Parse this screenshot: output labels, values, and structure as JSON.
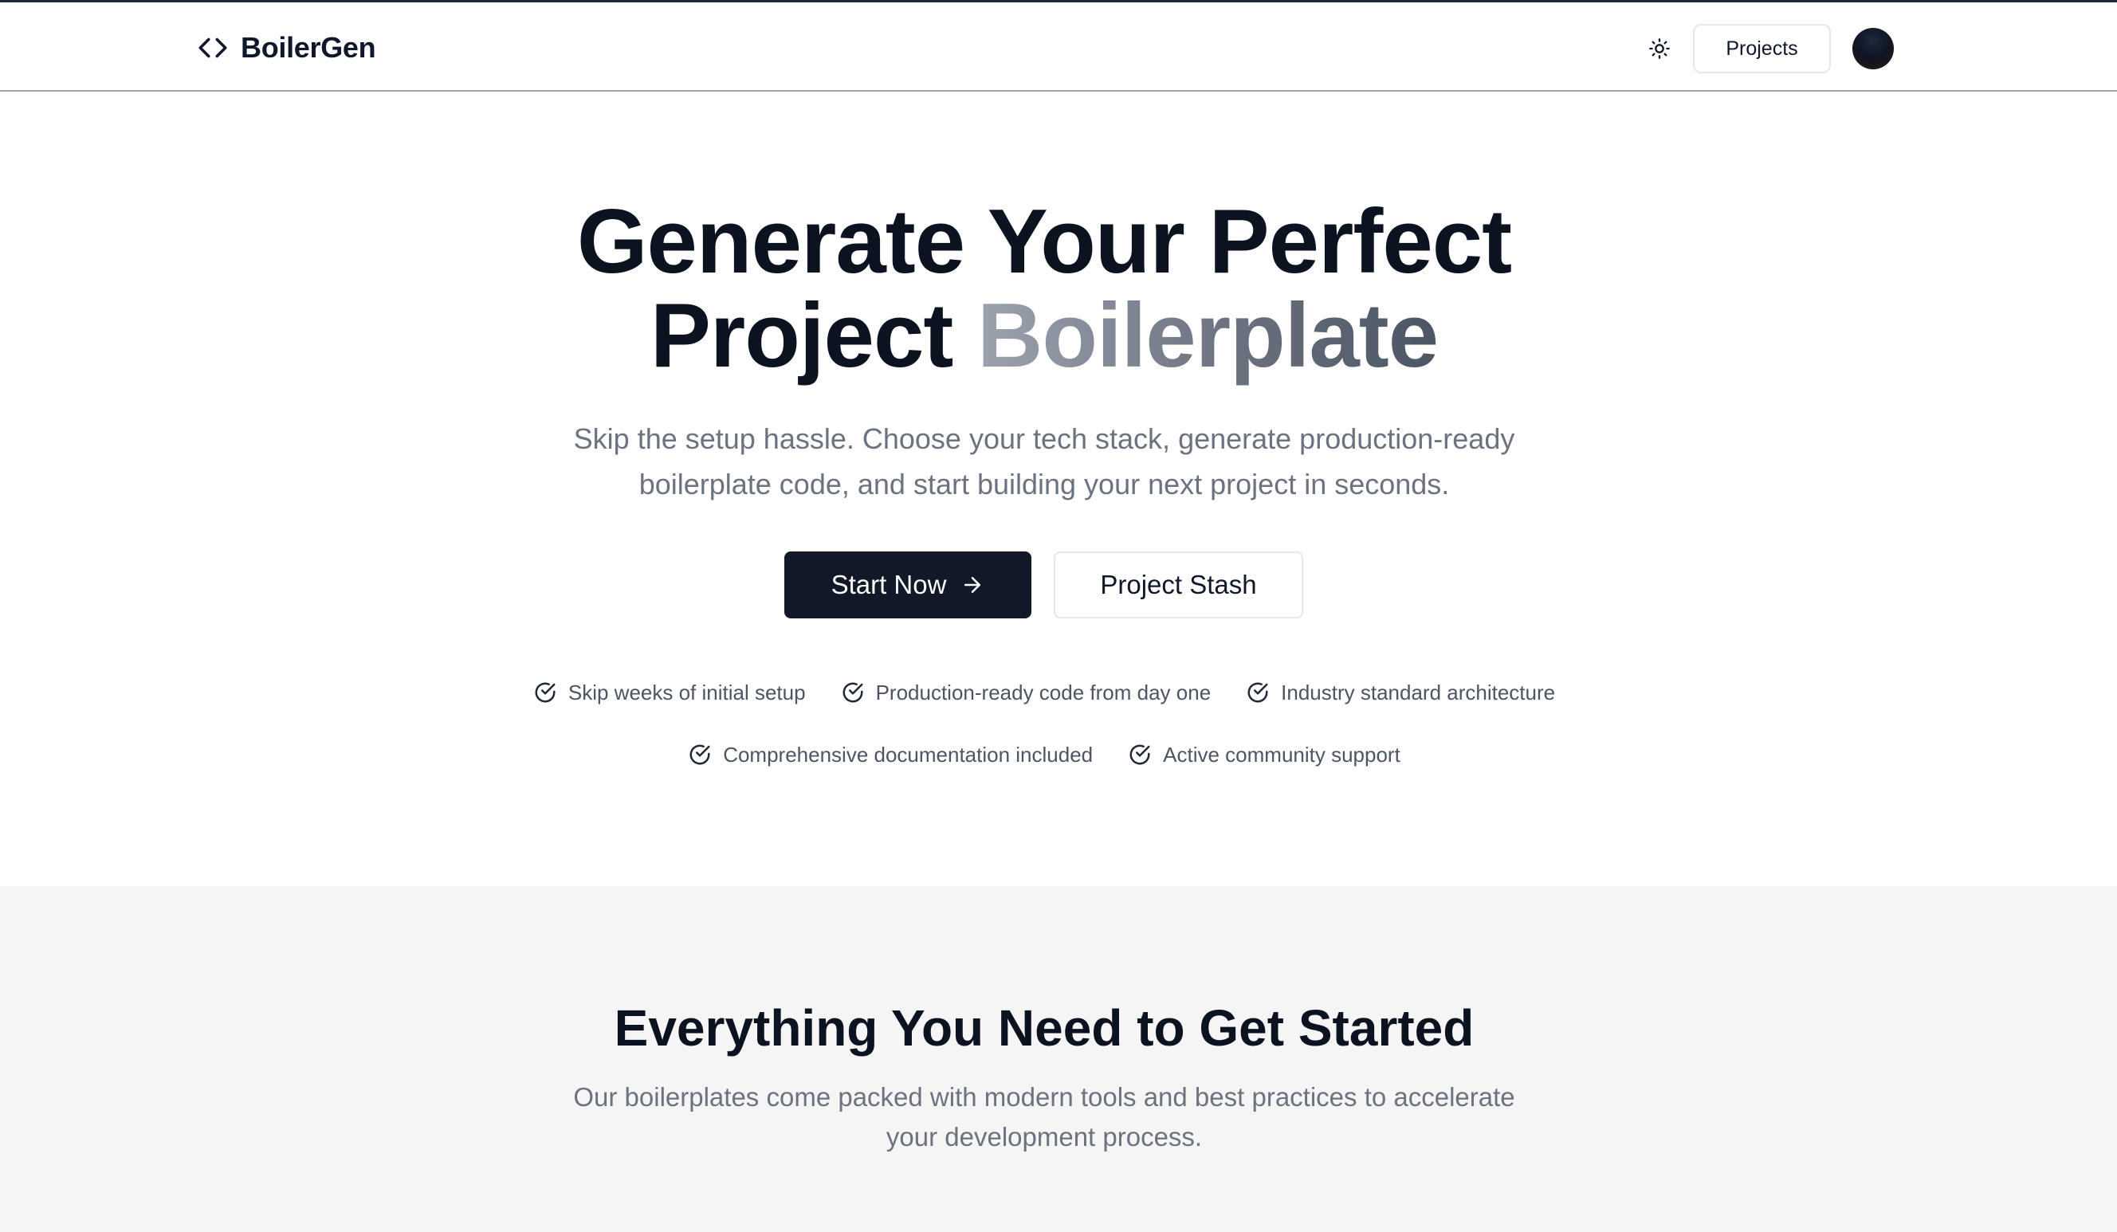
{
  "header": {
    "brand": "BoilerGen",
    "projects_label": "Projects"
  },
  "hero": {
    "title_line1": "Generate Your Perfect",
    "title_line2_plain": "Project",
    "title_line2_accent": "Boilerplate",
    "subtitle": "Skip the setup hassle. Choose your tech stack, generate production-ready boilerplate code, and start building your next project in seconds.",
    "primary_cta": "Start Now",
    "secondary_cta": "Project Stash"
  },
  "features": [
    "Skip weeks of initial setup",
    "Production-ready code from day one",
    "Industry standard architecture",
    "Comprehensive documentation included",
    "Active community support"
  ],
  "section2": {
    "title": "Everything You Need to Get Started",
    "subtitle": "Our boilerplates come packed with modern tools and best practices to accelerate your development process."
  },
  "colors": {
    "primary": "#111827",
    "text": "#0f172a",
    "muted": "#6b7280",
    "section_bg": "#f5f5f5"
  },
  "icons": {
    "brand": "code-brackets-icon",
    "theme": "sun-icon",
    "arrow": "arrow-right-icon",
    "feature": "check-circle-icon"
  }
}
